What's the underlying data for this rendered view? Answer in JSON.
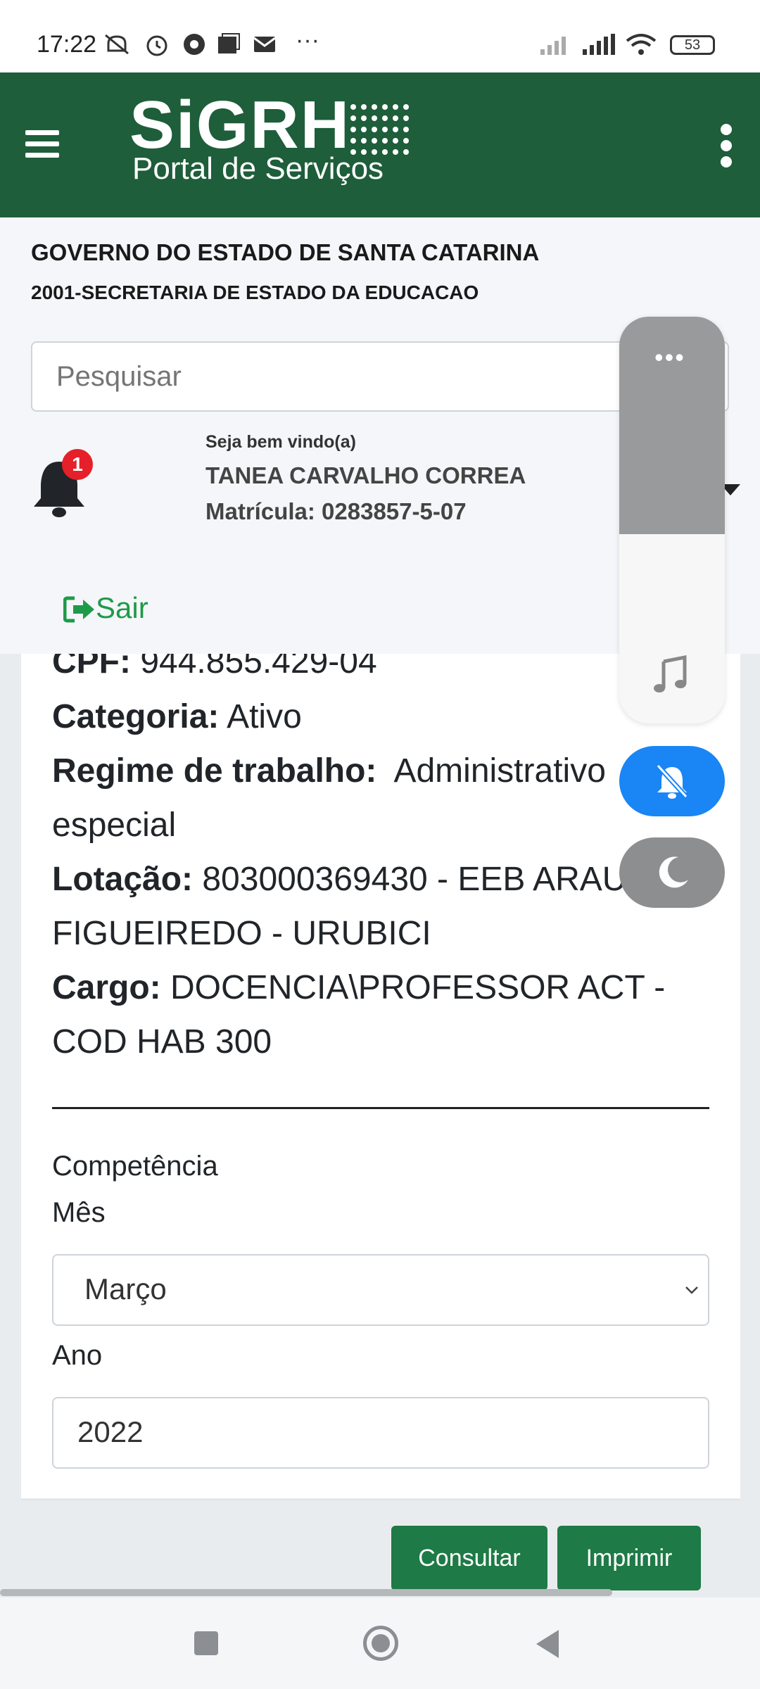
{
  "status_bar": {
    "time": "17:22",
    "battery": "53"
  },
  "header": {
    "logo_main": "SiGRH",
    "logo_sub": "Portal de Serviços"
  },
  "info": {
    "government": "GOVERNO DO ESTADO DE SANTA CATARINA",
    "secretariat": "2001-SECRETARIA DE ESTADO DA EDUCACAO",
    "search_placeholder": "Pesquisar",
    "notification_count": "1",
    "welcome": "Seja bem vindo(a)",
    "user_name": "TANEA CARVALHO CORREA",
    "matricula": "Matrícula: 0283857-5-07",
    "logout_label": "Sair"
  },
  "details": {
    "cpf_label": "CPF:",
    "cpf_value": "944.855.429-04",
    "categoria_label": "Categoria:",
    "categoria_value": "Ativo",
    "regime_label": "Regime de trabalho:",
    "regime_value_1": "Administrativo",
    "regime_value_2": "especial",
    "lotacao_label": "Lotação:",
    "lotacao_value_1": "803000369430 - EEB ARAU",
    "lotacao_value_2": "FIGUEIREDO - URUBICI",
    "cargo_label": "Cargo:",
    "cargo_value_1": "DOCENCIA\\PROFESSOR ACT -",
    "cargo_value_2": "COD HAB 300"
  },
  "form": {
    "competencia_label": "Competência",
    "mes_label": "Mês",
    "mes_value": "Março",
    "ano_label": "Ano",
    "ano_value": "2022",
    "consultar_label": "Consultar",
    "imprimir_label": "Imprimir"
  },
  "overlay": {
    "volume_level": 0.46,
    "dots": "•••"
  },
  "colors": {
    "header_green": "#1e5e3a",
    "button_green": "#1e7a46",
    "logout_green": "#1f9a4a",
    "badge_red": "#e5202a",
    "ring_blue": "#1a85f5"
  },
  "icons": [
    "menu-icon",
    "more-vert-icon",
    "bell-icon",
    "logout-icon",
    "chevron-down-icon",
    "music-note-icon",
    "bell-off-icon",
    "moon-icon"
  ]
}
